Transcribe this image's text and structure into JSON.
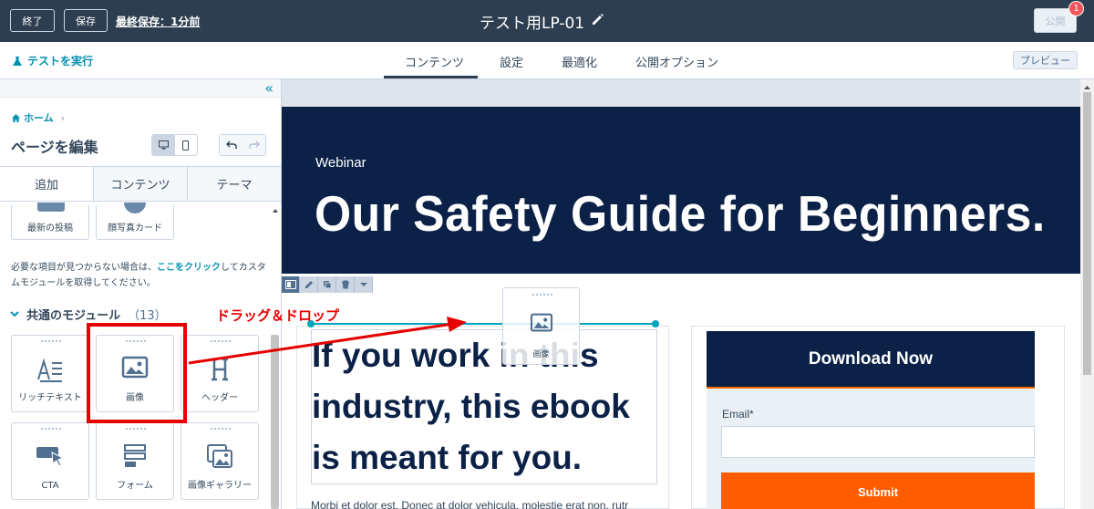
{
  "topbar": {
    "exit_label": "終了",
    "save_label": "保存",
    "last_saved": "最終保存：1分前",
    "page_title": "テスト用LP-01",
    "publish_label": "公開",
    "notification_count": "1"
  },
  "subbar": {
    "run_test": "テストを実行",
    "tabs": [
      "コンテンツ",
      "設定",
      "最適化",
      "公開オプション"
    ],
    "preview_label": "プレビュー"
  },
  "sidebar": {
    "breadcrumb_home": "ホーム",
    "breadcrumb_sep": "›",
    "edit_title": "ページを編集",
    "tabs": [
      "追加",
      "コンテンツ",
      "テーマ"
    ],
    "top_modules": [
      "最新の投稿",
      "顔写真カード"
    ],
    "help_before": "必要な項目が見つからない場合は、",
    "help_link": "ここをクリック",
    "help_after": "してカスタムモジュールを取得してください。",
    "section_title": "共通のモジュール",
    "section_count": "（13）",
    "modules": [
      "リッチテキスト",
      "画像",
      "ヘッダー",
      "CTA",
      "フォーム",
      "画像ギャラリー"
    ]
  },
  "annotation": {
    "drag_drop": "ドラッグ＆ドロップ"
  },
  "canvas": {
    "eyebrow": "Webinar",
    "hero_title": "Our Safety Guide for Beginners.",
    "body_heading": "If you work in this industry, this ebook is meant for you.",
    "body_lorem": "Morbi et dolor est. Donec at dolor vehicula, molestie erat non, rutr",
    "drag_ghost_label": "画像",
    "form": {
      "header": "Download Now",
      "email_label": "Email*",
      "submit_label": "Submit"
    }
  },
  "colors": {
    "topbar": "#2d3e50",
    "hero": "#0b2147",
    "accent": "#00a4bd",
    "submit": "#ff5c00",
    "annotation_red": "#e60000"
  }
}
